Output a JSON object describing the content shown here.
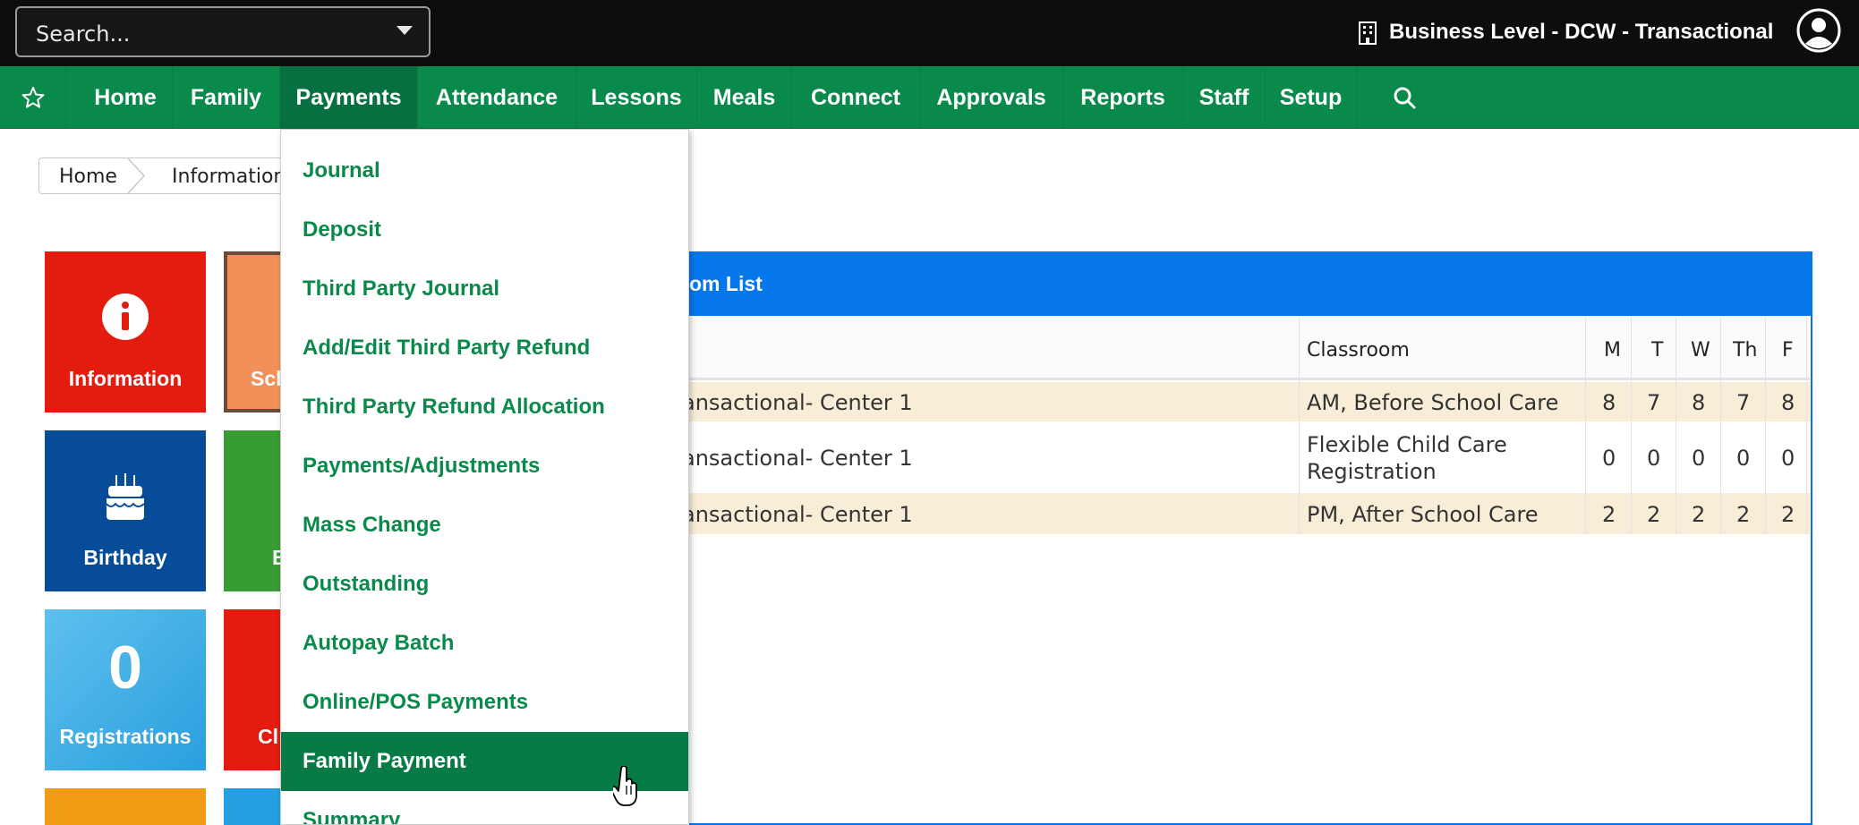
{
  "topbar": {
    "search_placeholder": "Search...",
    "business_label": "Business Level - DCW - Transactional"
  },
  "nav": {
    "items": [
      {
        "label": "Home"
      },
      {
        "label": "Family"
      },
      {
        "label": "Payments"
      },
      {
        "label": "Attendance"
      },
      {
        "label": "Lessons"
      },
      {
        "label": "Meals"
      },
      {
        "label": "Connect"
      },
      {
        "label": "Approvals"
      },
      {
        "label": "Reports"
      },
      {
        "label": "Staff"
      },
      {
        "label": "Setup"
      }
    ],
    "active": "Payments"
  },
  "breadcrumb": {
    "home": "Home",
    "current": "Information"
  },
  "tiles": [
    {
      "label": "Information",
      "color": "#e31c0f"
    },
    {
      "label": "Sch",
      "color": "#f2905a"
    },
    {
      "label": "Birthday",
      "color": "#064c98"
    },
    {
      "label": "B",
      "color": "#389c34"
    },
    {
      "label": "Registrations",
      "number": "0",
      "color": "#3aaee6"
    },
    {
      "label": "Cl",
      "color": "#e31c0f"
    },
    {
      "color": "#f29b14"
    },
    {
      "color": "#23a0e0"
    }
  ],
  "room_list": {
    "title_visible": "om List",
    "columns": {
      "classroom": "Classroom",
      "days": [
        "M",
        "T",
        "W",
        "Th",
        "F"
      ]
    },
    "rows": [
      {
        "center": "ansactional- Center 1",
        "classroom": "AM, Before School Care",
        "classroom_line2": "",
        "counts": [
          "8",
          "7",
          "8",
          "7",
          "8"
        ]
      },
      {
        "center": "ansactional- Center 1",
        "classroom": "Flexible Child Care",
        "classroom_line2": "Registration",
        "counts": [
          "0",
          "0",
          "0",
          "0",
          "0"
        ]
      },
      {
        "center": "ansactional- Center 1",
        "classroom": "PM, After School Care",
        "classroom_line2": "",
        "counts": [
          "2",
          "2",
          "2",
          "2",
          "2"
        ]
      }
    ]
  },
  "payments_menu": {
    "items": [
      "Journal",
      "Deposit",
      "Third Party Journal",
      "Add/Edit Third Party Refund",
      "Third Party Refund Allocation",
      "Payments/Adjustments",
      "Mass Change",
      "Outstanding",
      "Autopay Batch",
      "Online/POS Payments",
      "Family Payment",
      "Summary"
    ],
    "highlighted": "Family Payment"
  },
  "colors": {
    "nav_green": "#0a8a4a",
    "panel_blue": "#0677ea",
    "row_tan": "#f8edd7"
  },
  "icons": [
    "building-icon",
    "user-avatar-icon",
    "star-icon",
    "search-icon",
    "info-icon",
    "birthday-cake-icon",
    "hand-pointer-cursor"
  ]
}
